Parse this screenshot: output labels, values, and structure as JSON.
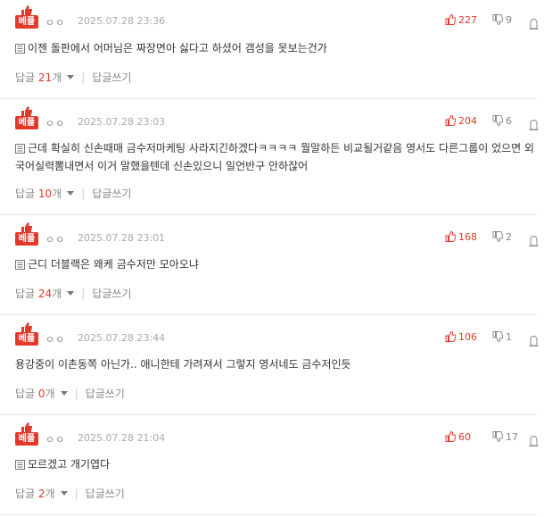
{
  "comments": [
    {
      "badge": "베플",
      "author": "ㅇㅇ",
      "date": "2025.07.28 23:36",
      "likes": "227",
      "dislikes": "9",
      "text": "이젠 돌판에서 어머님은 짜장면아 싫다고 하셨어 갬성을 못보는건가",
      "has_image": true,
      "reply_label": "답글",
      "reply_count": "21",
      "reply_unit": "개",
      "write_label": "답글쓰기"
    },
    {
      "badge": "베플",
      "author": "ㅇㅇ",
      "date": "2025.07.28 23:03",
      "likes": "204",
      "dislikes": "6",
      "text": "근데 확실히 신손때매 금수저마케팅 사라지긴하겠다ㅋㅋㅋㅋ 뭘말하든 비교될거같음 영서도 다른그룹이 었으면 외국어실력뽐내면서 이거 말했을텐데 신손있으니 일언반구 안하잖어",
      "has_image": true,
      "reply_label": "답글",
      "reply_count": "10",
      "reply_unit": "개",
      "write_label": "답글쓰기"
    },
    {
      "badge": "베플",
      "author": "ㅇㅇ",
      "date": "2025.07.28 23:01",
      "likes": "168",
      "dislikes": "2",
      "text": "근디 더블랙은 왜케 금수저만 모아오냐",
      "has_image": true,
      "reply_label": "답글",
      "reply_count": "24",
      "reply_unit": "개",
      "write_label": "답글쓰기"
    },
    {
      "badge": "베플",
      "author": "ㅇㅇ",
      "date": "2025.07.28 23:44",
      "likes": "106",
      "dislikes": "1",
      "text": "용강중이 이촌동쪽 아닌가.. 애니한테 가려져서 그렇지 영서네도 금수저인듯",
      "has_image": false,
      "reply_label": "답글",
      "reply_count": "0",
      "reply_unit": "개",
      "write_label": "답글쓰기"
    },
    {
      "badge": "베플",
      "author": "ㅇㅇ",
      "date": "2025.07.28 21:04",
      "likes": "60",
      "dislikes": "17",
      "text": "모르겠고 개기엽다",
      "has_image": true,
      "reply_label": "답글",
      "reply_count": "2",
      "reply_unit": "개",
      "write_label": "답글쓰기"
    }
  ],
  "colors": {
    "accent": "#e13a2c",
    "muted": "#888888",
    "border": "#e4e4e4"
  },
  "icons": {
    "like": "thumb-up-icon",
    "dislike": "thumb-down-icon",
    "report": "report-icon",
    "image": "image-icon"
  }
}
